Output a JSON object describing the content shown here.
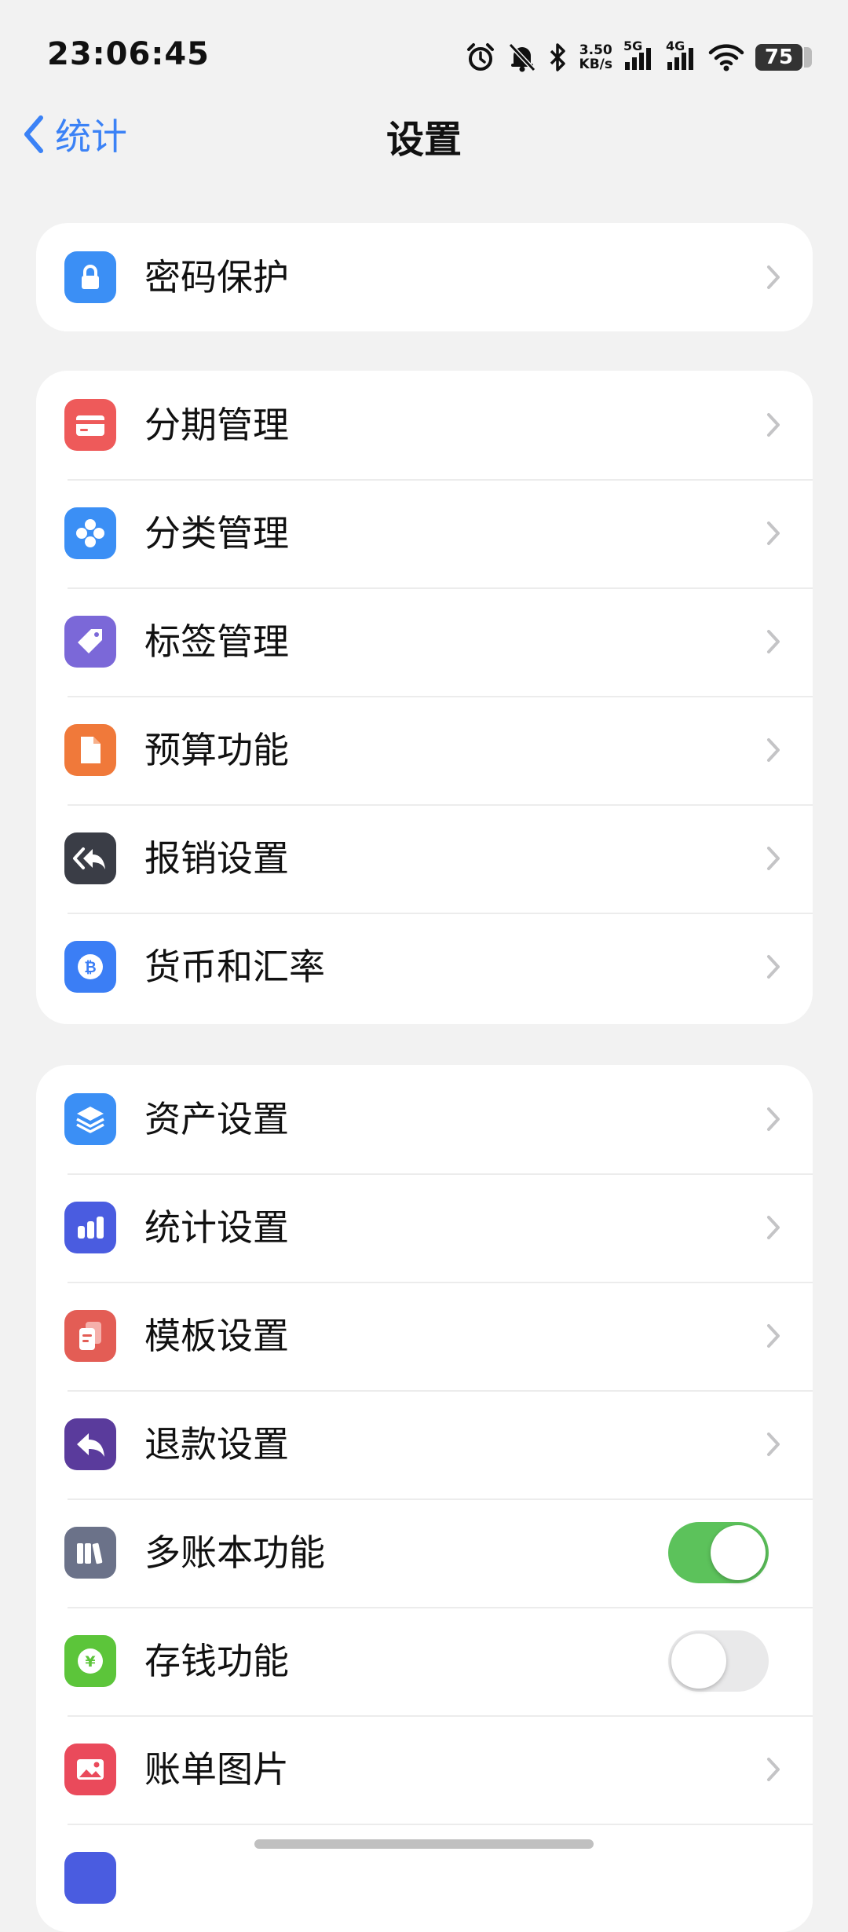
{
  "status_bar": {
    "time": "23:06:45",
    "net_speed_value": "3.50",
    "net_speed_unit": "KB/s",
    "sim1_label": "5G",
    "sim2_label": "4G",
    "battery": "75",
    "icons": [
      "alarm-icon",
      "bell-off-icon",
      "bluetooth-icon",
      "wifi-icon"
    ]
  },
  "nav": {
    "back_label": "统计",
    "title": "设置"
  },
  "groups": [
    {
      "items": [
        {
          "label": "密码保护",
          "icon": "lock-icon",
          "icon_color": "#3b8ff5",
          "control": "chevron"
        }
      ]
    },
    {
      "items": [
        {
          "label": "分期管理",
          "icon": "card-icon",
          "icon_color": "#ee5a5a",
          "control": "chevron"
        },
        {
          "label": "分类管理",
          "icon": "category-icon",
          "icon_color": "#3b8ff5",
          "control": "chevron"
        },
        {
          "label": "标签管理",
          "icon": "tag-icon",
          "icon_color": "#7b68d8",
          "control": "chevron"
        },
        {
          "label": "预算功能",
          "icon": "document-icon",
          "icon_color": "#f0793a",
          "control": "chevron"
        },
        {
          "label": "报销设置",
          "icon": "reply-all-icon",
          "icon_color": "#3a3d46",
          "control": "chevron"
        },
        {
          "label": "货币和汇率",
          "icon": "bitcoin-icon",
          "icon_color": "#3b7ef5",
          "control": "chevron"
        }
      ]
    },
    {
      "items": [
        {
          "label": "资产设置",
          "icon": "layers-icon",
          "icon_color": "#3b8ff5",
          "control": "chevron"
        },
        {
          "label": "统计设置",
          "icon": "bar-chart-icon",
          "icon_color": "#4a5ce0",
          "control": "chevron"
        },
        {
          "label": "模板设置",
          "icon": "template-icon",
          "icon_color": "#e35d55",
          "control": "chevron"
        },
        {
          "label": "退款设置",
          "icon": "reply-icon",
          "icon_color": "#5a3b9c",
          "control": "chevron"
        },
        {
          "label": "多账本功能",
          "icon": "books-icon",
          "icon_color": "#6b7289",
          "control": "toggle",
          "value": true
        },
        {
          "label": "存钱功能",
          "icon": "yen-coin-icon",
          "icon_color": "#5cc53a",
          "control": "toggle",
          "value": false
        },
        {
          "label": "账单图片",
          "icon": "image-icon",
          "icon_color": "#ea4a5b",
          "control": "chevron"
        },
        {
          "label": "",
          "icon": "partial-icon",
          "icon_color": "#4a5ce0",
          "control": "chevron"
        }
      ]
    }
  ]
}
